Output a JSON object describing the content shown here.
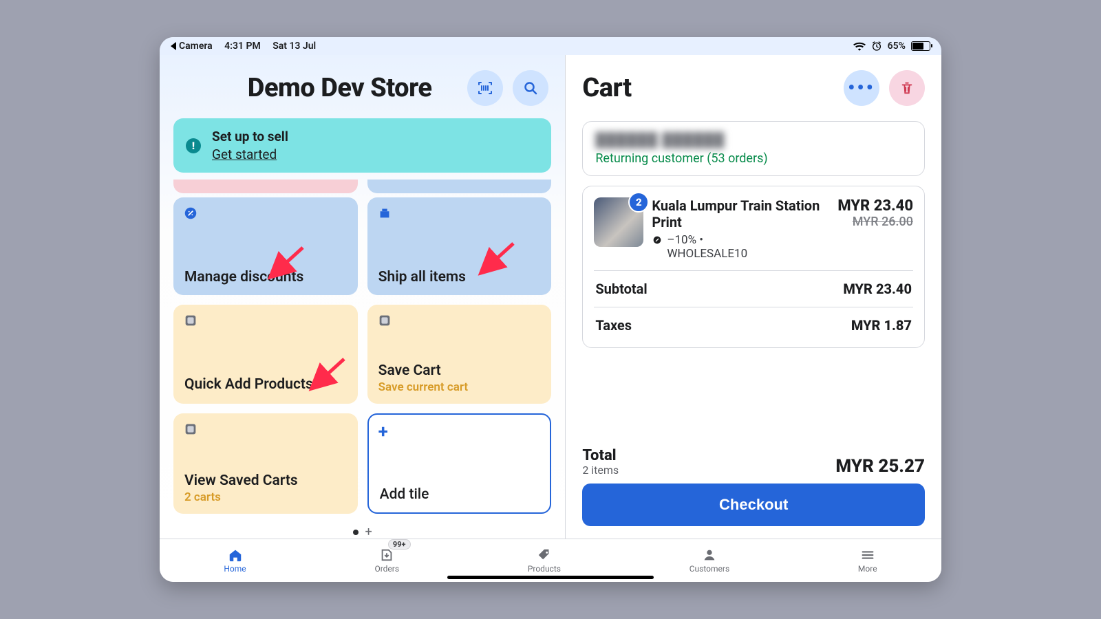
{
  "status": {
    "back_app": "Camera",
    "time": "4:31 PM",
    "date": "Sat 13 Jul",
    "battery_pct": "65%"
  },
  "left": {
    "title": "Demo Dev Store",
    "banner": {
      "title": "Set up to sell",
      "link": "Get started"
    },
    "tiles": {
      "manage_discounts": "Manage discounts",
      "ship_all": "Ship all items",
      "quick_add": "Quick Add Products",
      "save_cart": "Save Cart",
      "save_cart_sub": "Save current cart",
      "view_saved": "View Saved Carts",
      "view_saved_sub": "2 carts",
      "add_tile": "Add tile"
    }
  },
  "cart": {
    "title": "Cart",
    "customer": {
      "name": "██████ ██████",
      "status": "Returning customer (53 orders)"
    },
    "item": {
      "qty": "2",
      "title": "Kuala Lumpur Train Station Print",
      "discount": "–10% •",
      "discount_code": "WHOLESALE10",
      "price": "MYR 23.40",
      "compare": "MYR 26.00"
    },
    "subtotal": {
      "label": "Subtotal",
      "value": "MYR 23.40"
    },
    "taxes": {
      "label": "Taxes",
      "value": "MYR 1.87"
    },
    "total": {
      "label": "Total",
      "sub": "2 items",
      "value": "MYR 25.27"
    },
    "checkout": "Checkout"
  },
  "tabs": {
    "home": "Home",
    "orders": "Orders",
    "orders_badge": "99+",
    "products": "Products",
    "customers": "Customers",
    "more": "More"
  }
}
